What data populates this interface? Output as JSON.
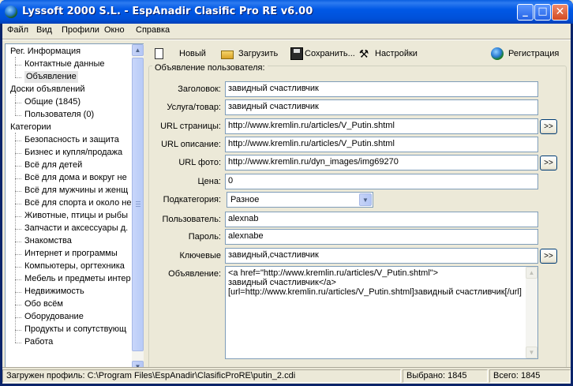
{
  "window": {
    "title": "Lyssoft 2000 S.L. - EspAnadir Clasific Pro RE v6.00",
    "minimize_label": "_",
    "maximize_label": "□",
    "close_label": "✕"
  },
  "menu": {
    "file": "Файл",
    "view": "Вид",
    "profiles": "Профили",
    "window": "Окно",
    "help": "Справка"
  },
  "tree": {
    "items": [
      {
        "label": "Рег. Информация",
        "level": 0
      },
      {
        "label": "Контактные данные",
        "level": 1
      },
      {
        "label": "Объявление",
        "level": 1,
        "selected": true
      },
      {
        "label": "Доски объявлений",
        "level": 0
      },
      {
        "label": "Общие (1845)",
        "level": 1
      },
      {
        "label": "Пользователя (0)",
        "level": 1
      },
      {
        "label": "Категории",
        "level": 0
      },
      {
        "label": "Безопасность и защита",
        "level": 1
      },
      {
        "label": "Бизнес и купля/продажа",
        "level": 1
      },
      {
        "label": "Всё для детей",
        "level": 1
      },
      {
        "label": "Всё для дома и вокруг не",
        "level": 1
      },
      {
        "label": "Всё для мужчины и женщ",
        "level": 1
      },
      {
        "label": "Всё для спорта и около не",
        "level": 1
      },
      {
        "label": "Животные, птицы и рыбы",
        "level": 1
      },
      {
        "label": "Запчасти и аксессуары д.",
        "level": 1
      },
      {
        "label": "Знакомства",
        "level": 1
      },
      {
        "label": "Интернет и программы",
        "level": 1
      },
      {
        "label": "Компьютеры, оргтехника",
        "level": 1
      },
      {
        "label": "Мебель и предметы интер",
        "level": 1
      },
      {
        "label": "Недвижимость",
        "level": 1
      },
      {
        "label": "Обо всём",
        "level": 1
      },
      {
        "label": "Оборудование",
        "level": 1
      },
      {
        "label": "Продукты и сопутствующ",
        "level": 1
      },
      {
        "label": "Работа",
        "level": 1
      }
    ]
  },
  "toolbar": {
    "new_label": "Новый",
    "load_label": "Загрузить",
    "save_label": "Сохранить...",
    "settings_label": "Настройки",
    "register_label": "Регистрация"
  },
  "form": {
    "group_title": "Объявление пользователя:",
    "title_label": "Заголовок:",
    "title_value": "завидный счастливчик",
    "service_label": "Услуга/товар:",
    "service_value": "завидный счастливчик",
    "page_url_label": "URL страницы:",
    "page_url_value": "http://www.kremlin.ru/articles/V_Putin.shtml",
    "desc_url_label": "URL описание:",
    "desc_url_value": "http://www.kremlin.ru/articles/V_Putin.shtml",
    "photo_url_label": "URL фото:",
    "photo_url_value": "http://www.kremlin.ru/dyn_images/img69270",
    "price_label": "Цена:",
    "price_value": "0",
    "subcategory_label": "Подкатегория:",
    "subcategory_value": "Разное",
    "user_label": "Пользователь:",
    "user_value": "alexnab",
    "password_label": "Пароль:",
    "password_value": "alexnabe",
    "keywords_label": "Ключевые",
    "keywords_value": "завидный,счастливчик",
    "ad_label": "Объявление:",
    "ad_lines": [
      "<a href=\"http://www.kremlin.ru/articles/V_Putin.shtml\">",
      "завидный счастливчик</a>",
      "[url=http://www.kremlin.ru/articles/V_Putin.shtml]завидный счастливчик[/url]"
    ],
    "go_button_label": ">>"
  },
  "status": {
    "profile": "Загружен профиль: C:\\Program Files\\EspAnadir\\ClasificProRE\\putin_2.cdi",
    "selected": "Выбрано: 1845",
    "total": "Всего: 1845"
  },
  "icons": {
    "new": "new-document-icon",
    "load": "open-folder-icon",
    "save": "floppy-disk-icon",
    "settings": "tools-icon",
    "register": "globe-icon"
  }
}
